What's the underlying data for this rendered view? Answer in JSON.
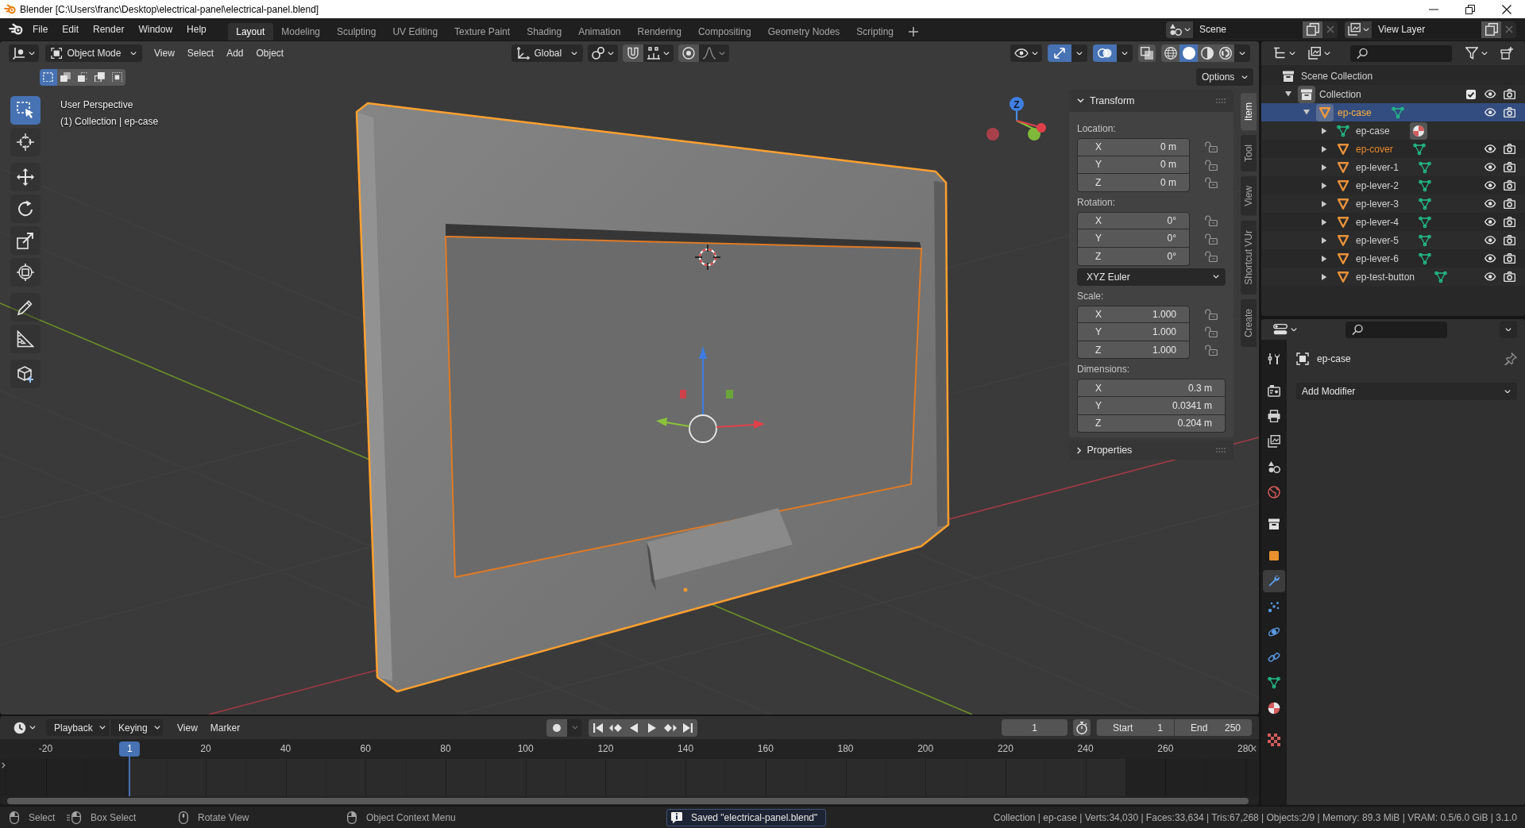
{
  "window": {
    "title": "Blender [C:\\Users\\franc\\Desktop\\electrical-panel\\electrical-panel.blend]"
  },
  "top_bar": {
    "menus": [
      "File",
      "Edit",
      "Render",
      "Window",
      "Help"
    ],
    "workspaces": [
      {
        "label": "Layout",
        "selected": true
      },
      {
        "label": "Modeling",
        "selected": false
      },
      {
        "label": "Sculpting",
        "selected": false
      },
      {
        "label": "UV Editing",
        "selected": false
      },
      {
        "label": "Texture Paint",
        "selected": false
      },
      {
        "label": "Shading",
        "selected": false
      },
      {
        "label": "Animation",
        "selected": false
      },
      {
        "label": "Rendering",
        "selected": false
      },
      {
        "label": "Compositing",
        "selected": false
      },
      {
        "label": "Geometry Nodes",
        "selected": false
      },
      {
        "label": "Scripting",
        "selected": false
      }
    ],
    "scene": "Scene",
    "view_layer": "View Layer"
  },
  "viewport": {
    "mode": "Object Mode",
    "menus": [
      "View",
      "Select",
      "Add",
      "Object"
    ],
    "orientation": "Global",
    "gizmos": {
      "on": true
    },
    "overlays": {
      "on": true
    },
    "xray": {
      "on": false
    },
    "shading_modes": [
      {
        "selected": false
      },
      {
        "selected": true
      },
      {
        "selected": false
      },
      {
        "selected": false
      }
    ],
    "select_modes": [
      {
        "selected": true
      },
      {
        "selected": false
      },
      {
        "selected": false
      },
      {
        "selected": false
      },
      {
        "selected": false
      }
    ],
    "options": "Options",
    "tools": [
      {
        "selected": true
      },
      {
        "selected": false
      },
      {
        "selected": false
      },
      {
        "selected": false
      },
      {
        "selected": false
      },
      {
        "selected": false
      },
      {
        "selected": false
      },
      {
        "selected": false
      },
      {
        "selected": false
      }
    ],
    "info": [
      "User Perspective",
      "(1) Collection | ep-case"
    ],
    "gizmo_axis": "Z"
  },
  "sidebar": {
    "tabs": [
      {
        "label": "Item",
        "selected": true
      },
      {
        "label": "Tool",
        "selected": false
      },
      {
        "label": "View",
        "selected": false
      },
      {
        "label": "Shortcut VUr",
        "selected": false
      },
      {
        "label": "Create",
        "selected": false
      }
    ],
    "transform": {
      "title": "Transform",
      "expanded": true,
      "groups": [
        {
          "label": "Location:",
          "fields": [
            {
              "axis": "X",
              "value": "0 m",
              "locked": false
            },
            {
              "axis": "Y",
              "value": "0 m",
              "locked": false
            },
            {
              "axis": "Z",
              "value": "0 m",
              "locked": false
            }
          ]
        },
        {
          "label": "Rotation:",
          "fields": [
            {
              "axis": "X",
              "value": "0°",
              "locked": false
            },
            {
              "axis": "Y",
              "value": "0°",
              "locked": false
            },
            {
              "axis": "Z",
              "value": "0°",
              "locked": false
            }
          ],
          "mode": "XYZ Euler"
        },
        {
          "label": "Scale:",
          "fields": [
            {
              "axis": "X",
              "value": "1.000",
              "locked": false
            },
            {
              "axis": "Y",
              "value": "1.000",
              "locked": false
            },
            {
              "axis": "Z",
              "value": "1.000",
              "locked": false
            }
          ]
        },
        {
          "label": "Dimensions:",
          "fields": [
            {
              "axis": "X",
              "value": "0.3 m"
            },
            {
              "axis": "Y",
              "value": "0.0341 m"
            },
            {
              "axis": "Z",
              "value": "0.204 m"
            }
          ]
        }
      ]
    },
    "properties_panel": {
      "title": "Properties",
      "expanded": false
    }
  },
  "outliner": {
    "tree": [
      {
        "label": "Scene Collection",
        "kind": "scene",
        "selected": false,
        "active": false,
        "children": [
          {
            "label": "Collection",
            "kind": "collection",
            "expanded": true,
            "checked": true,
            "visible": true,
            "selected": false,
            "active": false,
            "children": [
              {
                "label": "ep-case",
                "kind": "object",
                "expanded": true,
                "selected": true,
                "active": true,
                "visible": true,
                "children": [
                  {
                    "label": "ep-case",
                    "kind": "mesh",
                    "expanded": false,
                    "selected": false,
                    "active": false
                  },
                  {
                    "label": "ep-cover",
                    "kind": "object",
                    "expanded": false,
                    "selected": true,
                    "active": false,
                    "visible": true
                  },
                  {
                    "label": "ep-lever-1",
                    "kind": "object",
                    "expanded": false,
                    "selected": false,
                    "active": false,
                    "visible": true
                  },
                  {
                    "label": "ep-lever-2",
                    "kind": "object",
                    "expanded": false,
                    "selected": false,
                    "active": false,
                    "visible": true
                  },
                  {
                    "label": "ep-lever-3",
                    "kind": "object",
                    "expanded": false,
                    "selected": false,
                    "active": false,
                    "visible": true
                  },
                  {
                    "label": "ep-lever-4",
                    "kind": "object",
                    "expanded": false,
                    "selected": false,
                    "active": false,
                    "visible": true
                  },
                  {
                    "label": "ep-lever-5",
                    "kind": "object",
                    "expanded": false,
                    "selected": false,
                    "active": false,
                    "visible": true
                  },
                  {
                    "label": "ep-lever-6",
                    "kind": "object",
                    "expanded": false,
                    "selected": false,
                    "active": false,
                    "visible": true
                  },
                  {
                    "label": "ep-test-button",
                    "kind": "object",
                    "expanded": false,
                    "selected": false,
                    "active": false,
                    "visible": true
                  }
                ]
              }
            ]
          }
        ]
      }
    ]
  },
  "properties": {
    "tabs": [
      {
        "selected": false
      },
      {
        "selected": false
      },
      {
        "selected": false
      },
      {
        "selected": false
      },
      {
        "selected": false
      },
      {
        "selected": false
      },
      {
        "selected": false
      },
      {
        "selected": false
      },
      {
        "selected": true
      },
      {
        "selected": false
      },
      {
        "selected": false
      },
      {
        "selected": false
      },
      {
        "selected": false
      },
      {
        "selected": false
      },
      {
        "selected": false
      }
    ],
    "object_name": "ep-case",
    "add_modifier": "Add Modifier"
  },
  "timeline": {
    "menus": [
      {
        "label": "Playback",
        "kind": "dropdown"
      },
      {
        "label": "Keying",
        "kind": "dropdown"
      },
      {
        "label": "View",
        "kind": "menu"
      },
      {
        "label": "Marker",
        "kind": "menu"
      }
    ],
    "auto_keying": {
      "on": false
    },
    "current_frame": "1",
    "start": {
      "label": "Start",
      "value": "1"
    },
    "end": {
      "label": "End",
      "value": "250"
    },
    "ruler": [
      "-20",
      "20",
      "40",
      "60",
      "80",
      "100",
      "120",
      "140",
      "160",
      "180",
      "200",
      "220",
      "240",
      "260",
      "280"
    ],
    "playhead": "1"
  },
  "status_bar": {
    "hints": [
      "Select",
      "Box Select",
      "Rotate View",
      "Object Context Menu"
    ],
    "message": "Saved \"electrical-panel.blend\"",
    "stats": "Collection | ep-case | Verts:34,030 | Faces:33,634 | Tris:67,268 | Objects:2/9 | Memory: 89.3 MiB | VRAM: 0.5/6.0 GiB | 3.1.0"
  }
}
